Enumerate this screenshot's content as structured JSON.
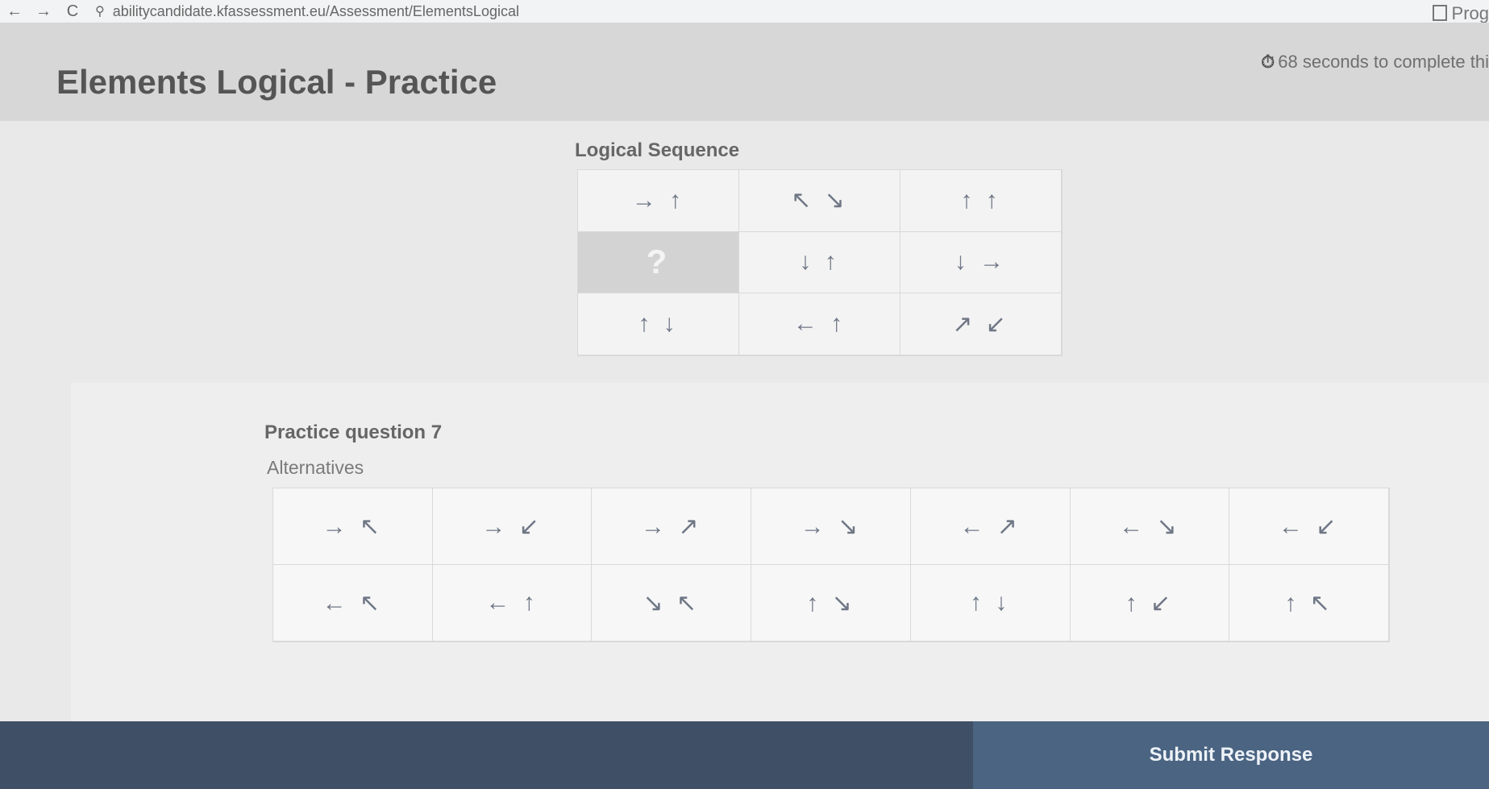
{
  "browser": {
    "back_icon": "←",
    "forward_icon": "→",
    "reload_icon": "C",
    "site_icon": "⚲",
    "url": "abilitycandidate.kfassessment.eu/Assessment/ElementsLogical",
    "right_label": "Prog"
  },
  "header": {
    "title": "Elements Logical - Practice",
    "timer_text": "68 seconds to complete thi",
    "timer_icon": "stopwatch-icon"
  },
  "sequence": {
    "title": "Logical Sequence",
    "cells": [
      [
        "→ ↑",
        "↖ ↘",
        "↑ ↑"
      ],
      [
        "?",
        "↓ ↑",
        "↓ →"
      ],
      [
        "↑ ↓",
        "← ↑",
        "↗ ↙"
      ]
    ]
  },
  "question": {
    "label": "Practice question 7",
    "alternatives_label": "Alternatives",
    "alternatives": [
      [
        "→ ↖",
        "→ ↙",
        "→ ↗",
        "→ ↘",
        "← ↗",
        "← ↘",
        "← ↙"
      ],
      [
        "← ↖",
        "← ↑",
        "↘ ↖",
        "↑ ↘",
        "↑ ↓",
        "↑ ↙",
        "↑ ↖"
      ]
    ]
  },
  "footer": {
    "submit_label": "Submit Response"
  }
}
